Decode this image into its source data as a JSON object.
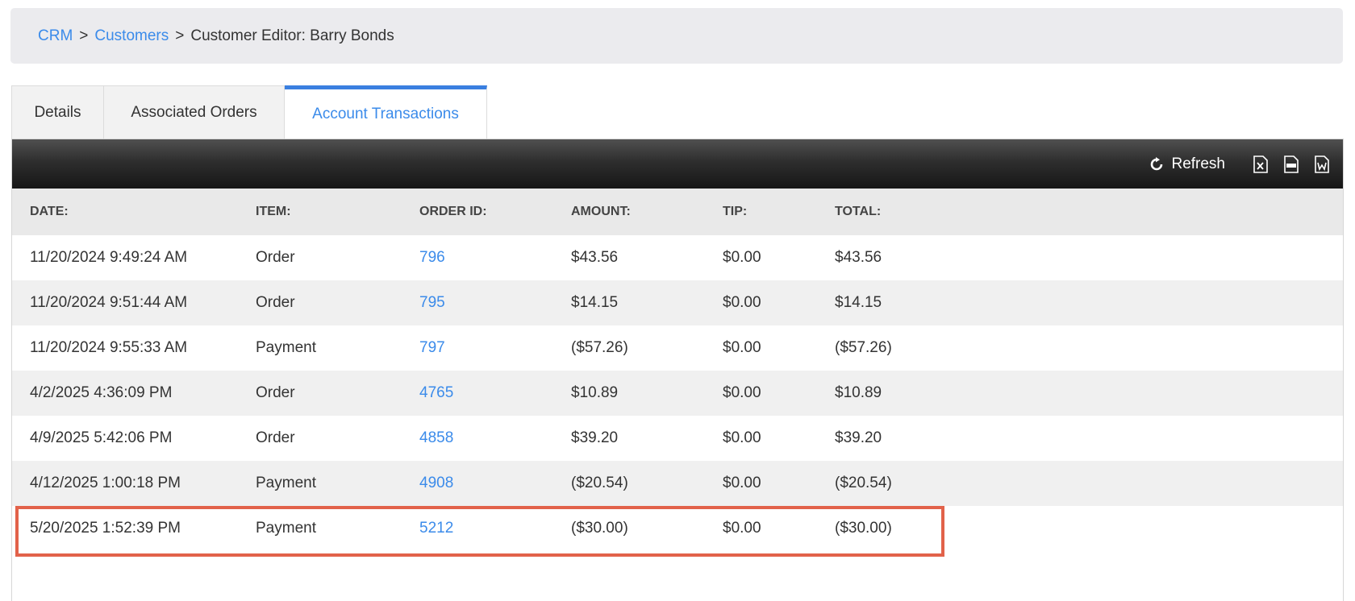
{
  "breadcrumb": {
    "crm": "CRM",
    "customers": "Customers",
    "sep1": ">",
    "sep2": ">",
    "current": "Customer Editor: Barry Bonds"
  },
  "tabs": [
    {
      "label": "Details"
    },
    {
      "label": "Associated Orders"
    },
    {
      "label": "Account Transactions"
    }
  ],
  "toolbar": {
    "refresh_label": "Refresh",
    "icons": [
      "excel-export-icon",
      "csv-export-icon",
      "word-export-icon"
    ]
  },
  "table": {
    "headers": [
      "DATE:",
      "ITEM:",
      "ORDER ID:",
      "AMOUNT:",
      "TIP:",
      "TOTAL:"
    ],
    "rows": [
      [
        "11/20/2024 9:49:24 AM",
        "Order",
        "796",
        "$43.56",
        "$0.00",
        "$43.56"
      ],
      [
        "11/20/2024 9:51:44 AM",
        "Order",
        "795",
        "$14.15",
        "$0.00",
        "$14.15"
      ],
      [
        "11/20/2024 9:55:33 AM",
        "Payment",
        "797",
        "($57.26)",
        "$0.00",
        "($57.26)"
      ],
      [
        "4/2/2025 4:36:09 PM",
        "Order",
        "4765",
        "$10.89",
        "$0.00",
        "$10.89"
      ],
      [
        "4/9/2025 5:42:06 PM",
        "Order",
        "4858",
        "$39.20",
        "$0.00",
        "$39.20"
      ],
      [
        "4/12/2025 1:00:18 PM",
        "Payment",
        "4908",
        "($20.54)",
        "$0.00",
        "($20.54)"
      ],
      [
        "5/20/2025 1:52:39 PM",
        "Payment",
        "5212",
        "($30.00)",
        "$0.00",
        "($30.00)"
      ]
    ]
  },
  "colors": {
    "link": "#3b8bea",
    "active_tab_border": "#3a7fe0",
    "highlight": "#e2624a"
  }
}
